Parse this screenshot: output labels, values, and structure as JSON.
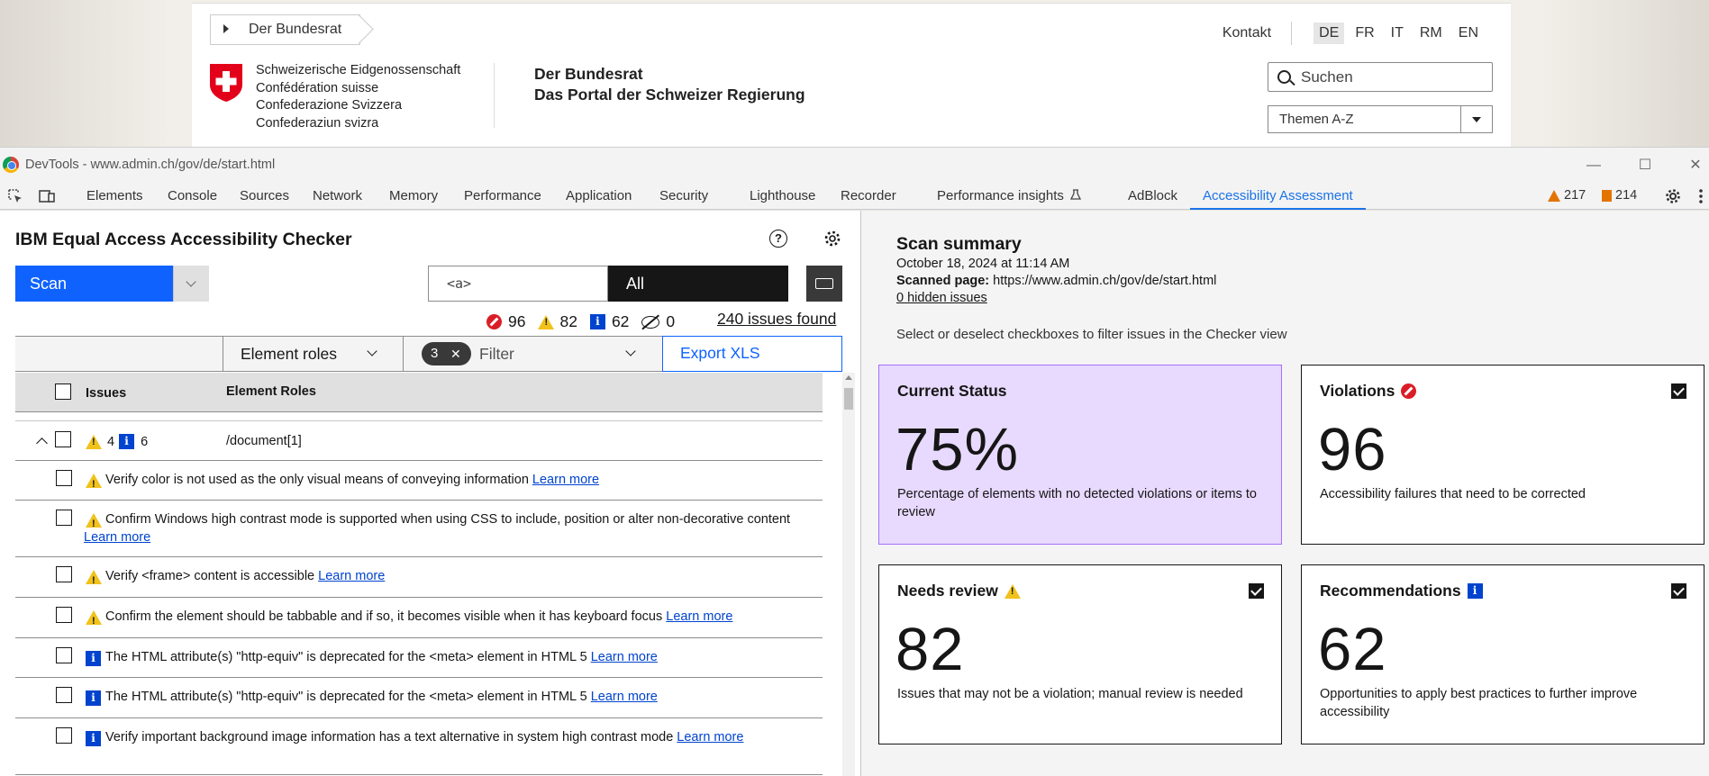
{
  "site": {
    "breadcrumb": "Der Bundesrat",
    "contact": "Kontakt",
    "languages": [
      "DE",
      "FR",
      "IT",
      "RM",
      "EN"
    ],
    "active_language": "DE",
    "confederation": [
      "Schweizerische Eidgenossenschaft",
      "Confédération suisse",
      "Confederazione Svizzera",
      "Confederaziun svizra"
    ],
    "portal_title": "Der Bundesrat",
    "portal_subtitle": "Das Portal der Schweizer Regierung",
    "search_placeholder": "Suchen",
    "topics_select": "Themen A-Z"
  },
  "devtools": {
    "window_title": "DevTools - www.admin.ch/gov/de/start.html",
    "tabs": [
      "Elements",
      "Console",
      "Sources",
      "Network",
      "Memory",
      "Performance",
      "Application",
      "Security",
      "Lighthouse",
      "Recorder",
      "Performance insights",
      "AdBlock",
      "Accessibility Assessment"
    ],
    "active_tab": "Accessibility Assessment",
    "warnings_count": "217",
    "issues_count": "214"
  },
  "checker": {
    "title": "IBM Equal Access Accessibility Checker",
    "scan_label": "Scan",
    "selector_value": "<a>",
    "scope_label": "All",
    "counts": {
      "violations": "96",
      "needs_review": "82",
      "recommendations": "62",
      "hidden": "0"
    },
    "issues_found": "240 issues found",
    "group_by": "Element roles",
    "filter_count": "3",
    "filter_label": "Filter",
    "export_label": "Export XLS",
    "columns": {
      "issues": "Issues",
      "roles": "Element Roles"
    },
    "group": {
      "warn_count": "4",
      "info_count": "6",
      "path": "/document[1]"
    },
    "learn_more": "Learn more",
    "issues": [
      {
        "type": "warn",
        "text": "Verify color is not used as the only visual means of conveying information"
      },
      {
        "type": "warn",
        "text": "Confirm Windows high contrast mode is supported when using CSS to include, position or alter non-decorative content"
      },
      {
        "type": "warn",
        "text": "Verify <frame> content is accessible"
      },
      {
        "type": "warn",
        "text": "Confirm the element should be tabbable and if so, it becomes visible when it has keyboard focus"
      },
      {
        "type": "info",
        "text": "The HTML attribute(s) \"http-equiv\" is deprecated for the <meta> element in HTML 5"
      },
      {
        "type": "info",
        "text": "The HTML attribute(s) \"http-equiv\" is deprecated for the <meta> element in HTML 5"
      },
      {
        "type": "info",
        "text": "Verify important background image information has a text alternative in system high contrast mode"
      }
    ]
  },
  "summary": {
    "title": "Scan summary",
    "date": "October 18, 2024 at 11:14 AM",
    "scanned_label": "Scanned page:",
    "scanned_url": "https://www.admin.ch/gov/de/start.html",
    "hidden_issues": "0 hidden issues",
    "note": "Select or deselect checkboxes to filter issues in the Checker view",
    "cards": {
      "status": {
        "title": "Current Status",
        "value": "75%",
        "desc": "Percentage of elements with no detected violations or items to review"
      },
      "violations": {
        "title": "Violations",
        "value": "96",
        "desc": "Accessibility failures that need to be corrected"
      },
      "review": {
        "title": "Needs review",
        "value": "82",
        "desc": "Issues that may not be a violation; manual review is needed"
      },
      "recommendations": {
        "title": "Recommendations",
        "value": "62",
        "desc": "Opportunities to apply best practices to further improve accessibility"
      }
    }
  }
}
